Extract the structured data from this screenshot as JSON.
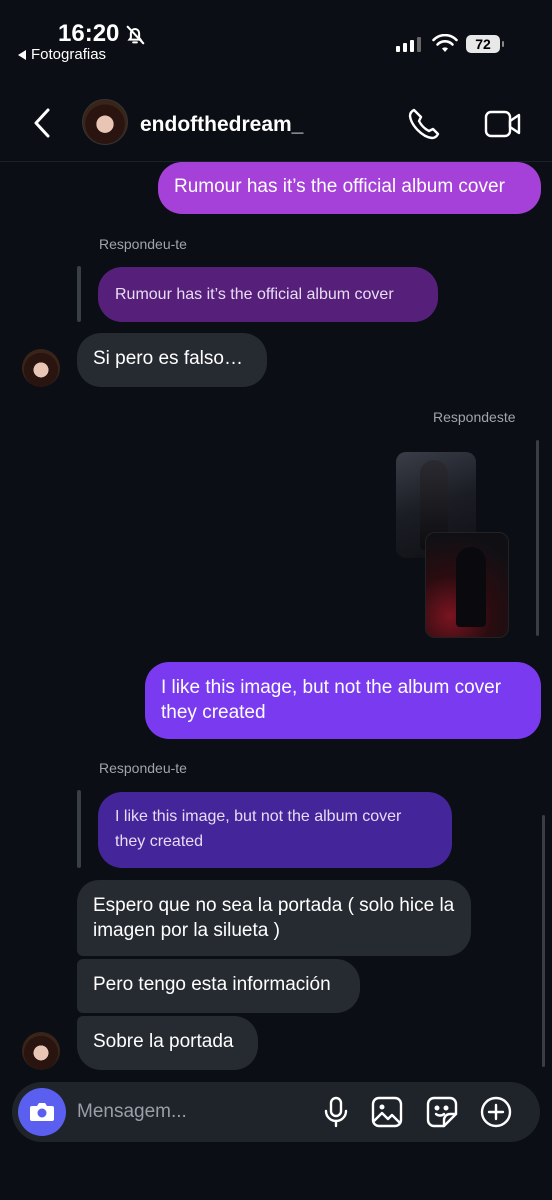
{
  "status_bar": {
    "time": "16:20",
    "back_app": "Fotografias",
    "battery": "72"
  },
  "header": {
    "username": "endofthedream_"
  },
  "messages": {
    "sent_1": "Rumour has it’s the official album cover",
    "reply_label_1": "Respondeu-te",
    "quote_1": "Rumour has it’s the official album cover",
    "received_1": "Si  pero es falso…",
    "reply_label_2": "Respondeste",
    "sent_2": "I like this image, but not the album cover they created",
    "reply_label_3": "Respondeu-te",
    "quote_2": "I like this image, but not the album cover they created",
    "received_2": "Espero que no sea la portada ( solo hice la imagen  por la silueta )",
    "received_3": "Pero tengo esta información",
    "received_4": "Sobre la portada"
  },
  "composer": {
    "placeholder": "Mensagem..."
  },
  "colors": {
    "background": "#0b0e14",
    "sent_pink": "#a540d8",
    "sent_purple": "#7a3af0",
    "received": "#262a31",
    "camera_button": "#5a5ff0"
  },
  "icons": [
    "bell-slash-icon",
    "signal-icon",
    "wifi-icon",
    "back-chevron-icon",
    "phone-icon",
    "video-camera-icon",
    "camera-icon",
    "microphone-icon",
    "gallery-icon",
    "sticker-icon",
    "plus-circle-icon"
  ]
}
